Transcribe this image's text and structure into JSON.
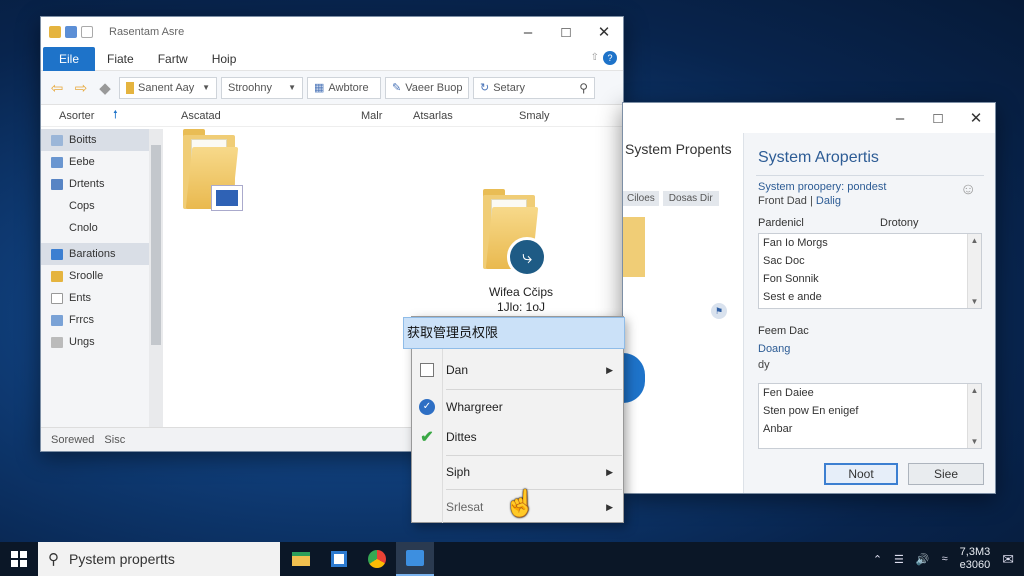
{
  "explorer": {
    "title": "Rasentam Asre",
    "menu": [
      "Eile",
      "Fiate",
      "Fartw",
      "Hoip"
    ],
    "toolbar": {
      "address": "Sanent Aay",
      "search1": "Stroohny",
      "btn_a": "Awbtore",
      "btn_b": "Vaeer Buop",
      "search2": "Setary"
    },
    "columns": [
      "Asorter",
      "Ascatad",
      "Malr",
      "Atsarlas",
      "Smaly"
    ],
    "sidebar": [
      "Boitts",
      "Eebe",
      "Drtents",
      "Cops",
      "Cnolo",
      "Barations",
      "Sroolle",
      "Ents",
      "Frrcs",
      "Ungs"
    ],
    "sidebar_selected": [
      0,
      5
    ],
    "folder_label_1": "Wifea Cčips",
    "folder_label_2": "1Jlo: 1oJ",
    "status": [
      "Sorewed",
      "Sisc"
    ]
  },
  "sysprop": {
    "left_title": "System Propents",
    "left_tabs": [
      "Ciloes",
      "Dosas Dir"
    ],
    "heading": "System Aropertis",
    "link1": "System proopery: pondest",
    "sub1": "Front Dad",
    "sub1_link": "Dalig",
    "col1": "Pardenicl",
    "col2": "Drotony",
    "list1": [
      "Fan Io Morgs",
      "Sac Doc",
      "Fon Sonnik",
      "Sest e ande"
    ],
    "label2": "Feem Dac",
    "link2": "Doang",
    "sub2": "dy",
    "list2_title": "Fen Daiee",
    "list2": [
      "Sten pow En enigef",
      "Anbar"
    ],
    "btn_ok": "Noot",
    "btn_cancel": "Siee"
  },
  "context_menu": {
    "highlighted": "获取管理员权限",
    "items": [
      {
        "label": "Dan",
        "submenu": true
      },
      {
        "label": "Whargreer",
        "submenu": false
      },
      {
        "label": "Dittes",
        "submenu": false
      },
      {
        "label": "Siph",
        "submenu": true
      },
      {
        "label": "Srlesat",
        "submenu": true
      }
    ]
  },
  "taskbar": {
    "search_text": "Pystem propertts",
    "clock_time": "7,3M3",
    "clock_date": "e3060"
  },
  "colors": {
    "accent": "#1e73c9",
    "folder": "#f0cd76",
    "highlight": "#cbe1f8"
  }
}
